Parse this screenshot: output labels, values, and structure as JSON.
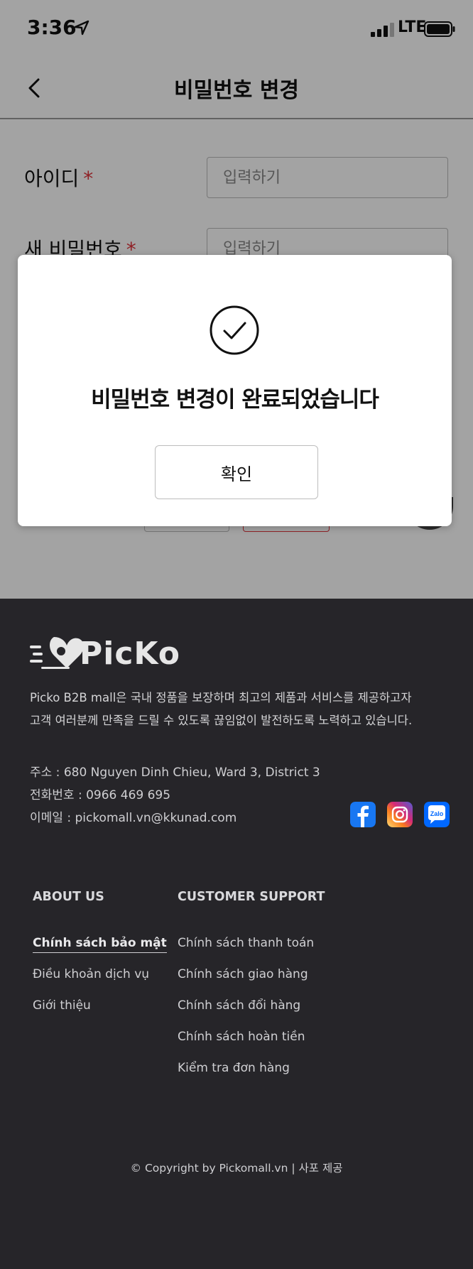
{
  "status_bar": {
    "time": "3:36",
    "network": "LTE"
  },
  "nav": {
    "title": "비밀번호 변경"
  },
  "form": {
    "id_label": "아이디",
    "required_mark": "*",
    "id_placeholder": "입력하기",
    "new_password_label": "새 비밀번호",
    "new_password_placeholder": "입력하기"
  },
  "modal": {
    "message": "비밀번호 변경이 완료되었습니다",
    "confirm_label": "확인"
  },
  "footer": {
    "logo_text": "PicKo",
    "description_line1": "Picko B2B mall은 국내 정품을 보장하며 최고의 제품과 서비스를 제공하고자",
    "description_line2": "고객 여러분께 만족을 드릴 수 있도록 끊임없이 발전하도록 노력하고 있습니다.",
    "address": "주소 : 680 Nguyen Dinh Chieu, Ward 3, District 3",
    "phone": "전화번호 : 0966 469 695",
    "email": "이메일 : pickomall.vn@kkunad.com",
    "social": [
      "facebook-icon",
      "instagram-icon",
      "zalo-icon"
    ],
    "zalo_label": "Zalo",
    "about_us": {
      "heading": "ABOUT US",
      "links": [
        "Chính sách bảo mật",
        "Điều khoản dịch vụ",
        "Giới thiệu"
      ]
    },
    "customer_support": {
      "heading": "CUSTOMER SUPPORT",
      "links": [
        "Chính sách thanh toán",
        "Chính sách giao hàng",
        "Chính sách đổi hàng",
        "Chính sách hoàn tiền",
        "Kiểm tra đơn hàng"
      ]
    },
    "copyright": "© Copyright by Pickomall.vn | 사포 제공"
  },
  "colors": {
    "required": "#e0343c",
    "footer_bg": "#262529",
    "overlay": "rgba(0,0,0,0.36)"
  }
}
